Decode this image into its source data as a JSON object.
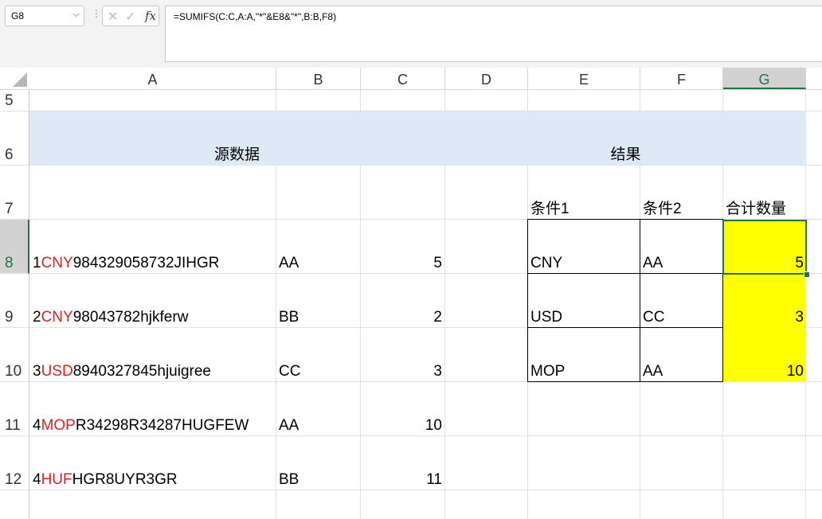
{
  "name_box": {
    "value": "G8",
    "dropdown_icon": "chevron-down-icon"
  },
  "formula_bar": {
    "cancel_icon": "close-icon",
    "enter_icon": "check-icon",
    "function_label": "fx",
    "formula": "=SUMIFS(C:C,A:A,\"*\"&E8&\"*\",B:B,F8)"
  },
  "columns": [
    "A",
    "B",
    "C",
    "D",
    "E",
    "F",
    "G"
  ],
  "selected_column": "G",
  "rows": [
    "5",
    "6",
    "7",
    "8",
    "9",
    "10",
    "11",
    "12"
  ],
  "selected_row": "8",
  "headers": {
    "source_title": "源数据",
    "result_title": "结果",
    "cond1": "条件1",
    "cond2": "条件2",
    "total": "合计数量"
  },
  "source_rows": [
    {
      "a_prefix": "1",
      "a_code": "CNY",
      "a_rest": "984329058732JIHGR",
      "b": "AA",
      "c": "5"
    },
    {
      "a_prefix": "2",
      "a_code": "CNY",
      "a_rest": "98043782hjkferw",
      "b": "BB",
      "c": "2"
    },
    {
      "a_prefix": "3",
      "a_code": "USD",
      "a_rest": "8940327845hjuigree",
      "b": "CC",
      "c": "3"
    },
    {
      "a_prefix": "4",
      "a_code": "MOP",
      "a_rest": "R34298R34287HUGFEW",
      "b": "AA",
      "c": "10"
    },
    {
      "a_prefix": "4",
      "a_code": "HUF",
      "a_rest": "HGR8UYR3GR",
      "b": "BB",
      "c": "11"
    }
  ],
  "result_rows": [
    {
      "e": "CNY",
      "f": "AA",
      "g": "5"
    },
    {
      "e": "USD",
      "f": "CC",
      "g": "3"
    },
    {
      "e": "MOP",
      "f": "AA",
      "g": "10"
    }
  ],
  "colors": {
    "highlight": "#ffff00",
    "band": "#dde9f4",
    "code": "#e02020",
    "select": "#217346"
  }
}
